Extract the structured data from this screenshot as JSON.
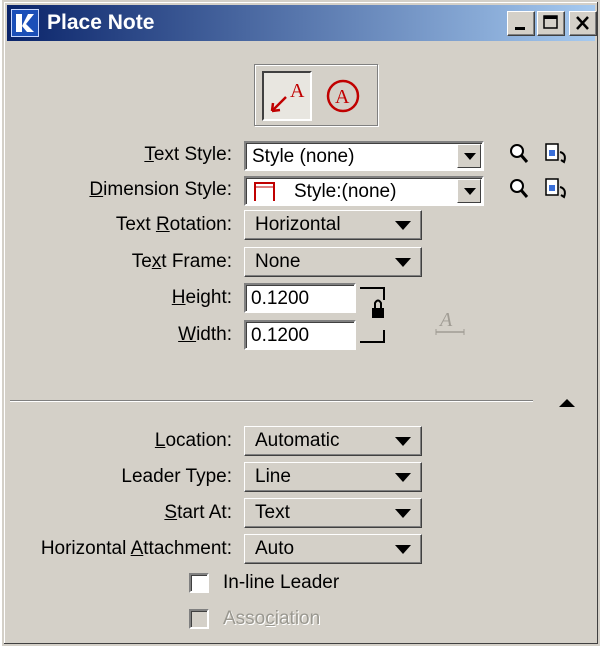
{
  "window": {
    "title": "Place Note"
  },
  "titlebar": {
    "minimize": "_",
    "maximize": "□",
    "close": "✕"
  },
  "tools": [
    {
      "name": "Place Note",
      "active": true,
      "glyph": "A"
    },
    {
      "name": "Place Text Note",
      "active": false,
      "glyph": "A"
    }
  ],
  "fields": {
    "text_style": {
      "label_pre": "",
      "label_u": "T",
      "label_post": "ext Style:",
      "value": "Style (none)"
    },
    "dimension_style": {
      "label_pre": "",
      "label_u": "D",
      "label_post": "imension Style:",
      "value": "Style:(none)"
    },
    "text_rotation": {
      "label_pre": "Text ",
      "label_u": "R",
      "label_post": "otation:",
      "value": "Horizontal"
    },
    "text_frame": {
      "label_pre": "Te",
      "label_u": "x",
      "label_post": "t Frame:",
      "value": "None"
    },
    "height": {
      "label_pre": "",
      "label_u": "H",
      "label_post": "eight:",
      "value": "0.1200"
    },
    "width": {
      "label_pre": "",
      "label_u": "W",
      "label_post": "idth:",
      "value": "0.1200"
    }
  },
  "leader": {
    "location": {
      "label_pre": "",
      "label_u": "L",
      "label_post": "ocation:",
      "value": "Automatic"
    },
    "leader_type": {
      "label": "Leader Type:",
      "value": "Line"
    },
    "start_at": {
      "label_pre": "",
      "label_u": "S",
      "label_post": "tart At:",
      "value": "Text"
    },
    "horizontal_attachment": {
      "label_pre": "Horizontal ",
      "label_u": "A",
      "label_post": "ttachment:",
      "value": "Auto"
    },
    "inline_leader": {
      "label": "In-line Leader",
      "checked": false
    },
    "association": {
      "label_pre": "Asso",
      "label_u": "c",
      "label_post": "iation",
      "checked": false,
      "enabled": false
    }
  },
  "colors": {
    "accent": "#0a246a",
    "tool_red": "#c00000"
  }
}
